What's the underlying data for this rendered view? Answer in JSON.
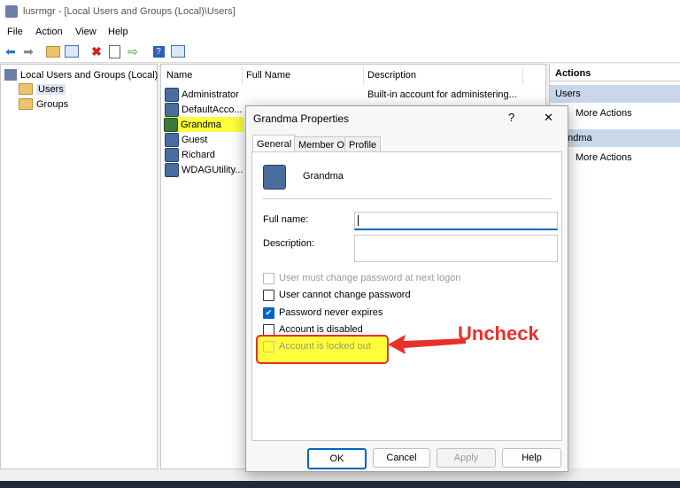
{
  "window": {
    "title": "lusrmgr - [Local Users and Groups (Local)\\Users]"
  },
  "menu": [
    "File",
    "Action",
    "View",
    "Help"
  ],
  "tree": {
    "root": "Local Users and Groups (Local)",
    "children": [
      "Users",
      "Groups"
    ]
  },
  "list": {
    "columns": [
      "Name",
      "Full Name",
      "Description"
    ],
    "rows": [
      {
        "name": "Administrator",
        "full": "",
        "desc": "Built-in account for administering..."
      },
      {
        "name": "DefaultAcco...",
        "full": "",
        "desc": ""
      },
      {
        "name": "Grandma",
        "full": "",
        "desc": ""
      },
      {
        "name": "Guest",
        "full": "",
        "desc": ""
      },
      {
        "name": "Richard",
        "full": "",
        "desc": ""
      },
      {
        "name": "WDAGUtility...",
        "full": "",
        "desc": ""
      }
    ]
  },
  "actions": {
    "header": "Actions",
    "section1": "Users",
    "more1": "More Actions",
    "section2": "Grandma",
    "section2_visible": "andma",
    "more2": "More Actions"
  },
  "dialog": {
    "title": "Grandma Properties",
    "help": "?",
    "close": "✕",
    "tabs": [
      "General",
      "Member Of",
      "Profile"
    ],
    "username": "Grandma",
    "fullname_label": "Full name:",
    "fullname_value": "",
    "description_label": "Description:",
    "description_value": "",
    "options": [
      {
        "label": "User must change password at next logon",
        "checked": false,
        "disabled": true
      },
      {
        "label": "User cannot change password",
        "checked": false,
        "disabled": false
      },
      {
        "label": "Password never expires",
        "checked": true,
        "disabled": false
      },
      {
        "label": "Account is disabled",
        "checked": false,
        "disabled": false
      },
      {
        "label": "Account is locked out",
        "checked": false,
        "disabled": true
      }
    ],
    "buttons": {
      "ok": "OK",
      "cancel": "Cancel",
      "apply": "Apply",
      "help": "Help"
    }
  },
  "annotation": {
    "text": "Uncheck",
    "color": "#e8302a"
  },
  "colors": {
    "highlight": "#ffff3b",
    "accent": "#0067c0"
  }
}
